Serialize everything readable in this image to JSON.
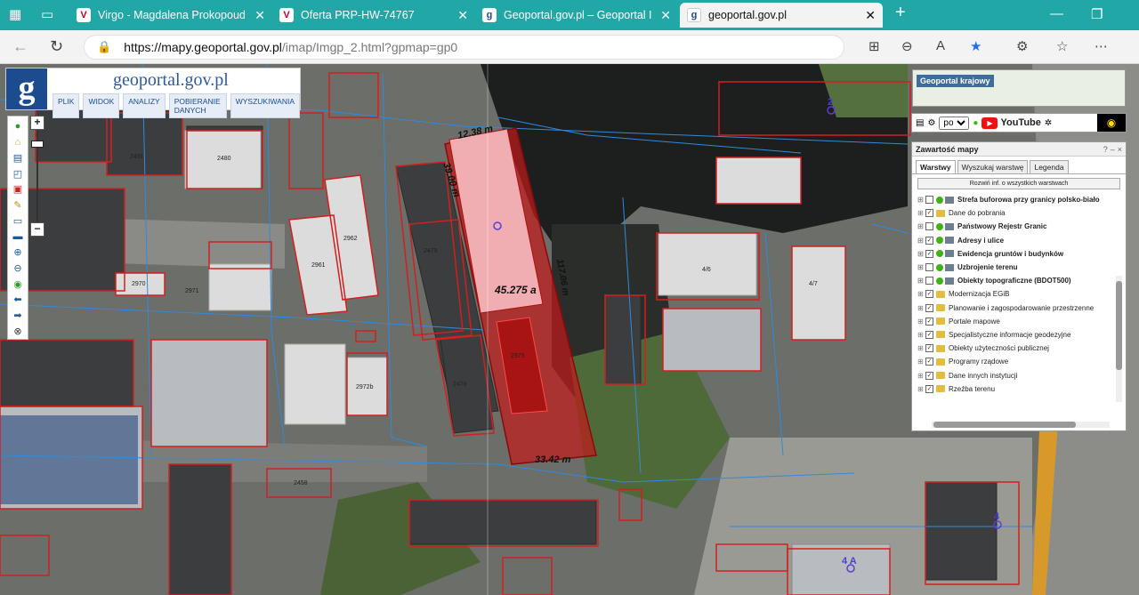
{
  "browser": {
    "tabs": [
      {
        "title": "Virgo - Magdalena Prokopoudi",
        "favicon": "virgo-icon"
      },
      {
        "title": "Oferta PRP-HW-74767",
        "favicon": "offer-icon"
      },
      {
        "title": "Geoportal.gov.pl – Geoportal Infr",
        "favicon": "geoportal-icon"
      },
      {
        "title": "geoportal.gov.pl",
        "favicon": "geoportal-icon",
        "active": true
      }
    ],
    "url_host": "https://mapy.geoportal.gov.pl",
    "url_path": "/imap/Imgp_2.html?gpmap=gp0"
  },
  "geoportal": {
    "brand": "geoportal.gov.pl",
    "menu": [
      "PLIK",
      "WIDOK",
      "ANALIZY",
      "POBIERANIE DANYCH",
      "WYSZUKIWANIA"
    ],
    "overview_title": "Geoportal krajowy",
    "language": "pol",
    "youtube_label": "YouTube"
  },
  "panel": {
    "title": "Zawartość mapy",
    "tabs": [
      "Warstwy",
      "Wyszukaj warstwę",
      "Legenda"
    ],
    "expand_button": "Rozwiń inf. o wszystkich warstwach",
    "layers": [
      {
        "label": "Strefa buforowa przy granicy polsko-biało",
        "bold": true,
        "checked": false,
        "type": "dot"
      },
      {
        "label": "Dane do pobrania",
        "bold": false,
        "checked": true,
        "type": "fold"
      },
      {
        "label": "Państwowy Rejestr Granic",
        "bold": true,
        "checked": false,
        "type": "dot"
      },
      {
        "label": "Adresy i ulice",
        "bold": true,
        "checked": true,
        "type": "dot"
      },
      {
        "label": "Ewidencja gruntów i budynków",
        "bold": true,
        "checked": true,
        "type": "dot"
      },
      {
        "label": "Uzbrojenie terenu",
        "bold": true,
        "checked": false,
        "type": "dot"
      },
      {
        "label": "Obiekty topograficzne (BDOT500)",
        "bold": true,
        "checked": false,
        "type": "dot"
      },
      {
        "label": "Modernizacja EGiB",
        "bold": false,
        "checked": true,
        "type": "fold"
      },
      {
        "label": "Planowanie i zagospodarowanie przestrzenne",
        "bold": false,
        "checked": true,
        "type": "fold"
      },
      {
        "label": "Portale mapowe",
        "bold": false,
        "checked": true,
        "type": "fold"
      },
      {
        "label": "Specjalistyczne informacje geodezyjne",
        "bold": false,
        "checked": true,
        "type": "fold"
      },
      {
        "label": "Obiekty użyteczności publicznej",
        "bold": false,
        "checked": true,
        "type": "fold"
      },
      {
        "label": "Programy rządowe",
        "bold": false,
        "checked": true,
        "type": "fold"
      },
      {
        "label": "Dane innych instytucji",
        "bold": false,
        "checked": true,
        "type": "fold"
      },
      {
        "label": "Rzeźba terenu",
        "bold": false,
        "checked": true,
        "type": "fold"
      }
    ]
  },
  "map": {
    "measurements": {
      "area": "45.275 a",
      "top_edge": "12.38 m",
      "left_edge": "39.00 m",
      "right_edge": "117.06 m",
      "bottom_edge": "33.42 m"
    },
    "parcel_labels": [
      "2481",
      "2479",
      "2480",
      "2478",
      "2970",
      "2962",
      "2961",
      "2971",
      "2972b",
      "2975",
      "4/7",
      "4/6",
      "2458"
    ],
    "address_numbers": [
      "2",
      "4",
      "4 A"
    ]
  }
}
